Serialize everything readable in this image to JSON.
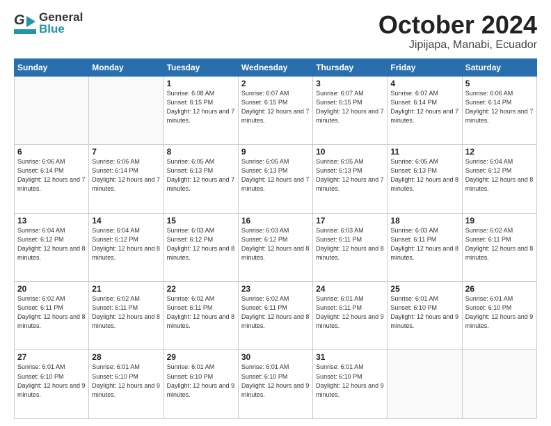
{
  "header": {
    "logo_general": "General",
    "logo_blue": "Blue",
    "title": "October 2024",
    "subtitle": "Jipijapa, Manabi, Ecuador"
  },
  "calendar": {
    "days_of_week": [
      "Sunday",
      "Monday",
      "Tuesday",
      "Wednesday",
      "Thursday",
      "Friday",
      "Saturday"
    ],
    "weeks": [
      [
        {
          "day": "",
          "detail": ""
        },
        {
          "day": "",
          "detail": ""
        },
        {
          "day": "1",
          "detail": "Sunrise: 6:08 AM\nSunset: 6:15 PM\nDaylight: 12 hours\nand 7 minutes."
        },
        {
          "day": "2",
          "detail": "Sunrise: 6:07 AM\nSunset: 6:15 PM\nDaylight: 12 hours\nand 7 minutes."
        },
        {
          "day": "3",
          "detail": "Sunrise: 6:07 AM\nSunset: 6:15 PM\nDaylight: 12 hours\nand 7 minutes."
        },
        {
          "day": "4",
          "detail": "Sunrise: 6:07 AM\nSunset: 6:14 PM\nDaylight: 12 hours\nand 7 minutes."
        },
        {
          "day": "5",
          "detail": "Sunrise: 6:06 AM\nSunset: 6:14 PM\nDaylight: 12 hours\nand 7 minutes."
        }
      ],
      [
        {
          "day": "6",
          "detail": "Sunrise: 6:06 AM\nSunset: 6:14 PM\nDaylight: 12 hours\nand 7 minutes."
        },
        {
          "day": "7",
          "detail": "Sunrise: 6:06 AM\nSunset: 6:14 PM\nDaylight: 12 hours\nand 7 minutes."
        },
        {
          "day": "8",
          "detail": "Sunrise: 6:05 AM\nSunset: 6:13 PM\nDaylight: 12 hours\nand 7 minutes."
        },
        {
          "day": "9",
          "detail": "Sunrise: 6:05 AM\nSunset: 6:13 PM\nDaylight: 12 hours\nand 7 minutes."
        },
        {
          "day": "10",
          "detail": "Sunrise: 6:05 AM\nSunset: 6:13 PM\nDaylight: 12 hours\nand 7 minutes."
        },
        {
          "day": "11",
          "detail": "Sunrise: 6:05 AM\nSunset: 6:13 PM\nDaylight: 12 hours\nand 8 minutes."
        },
        {
          "day": "12",
          "detail": "Sunrise: 6:04 AM\nSunset: 6:12 PM\nDaylight: 12 hours\nand 8 minutes."
        }
      ],
      [
        {
          "day": "13",
          "detail": "Sunrise: 6:04 AM\nSunset: 6:12 PM\nDaylight: 12 hours\nand 8 minutes."
        },
        {
          "day": "14",
          "detail": "Sunrise: 6:04 AM\nSunset: 6:12 PM\nDaylight: 12 hours\nand 8 minutes."
        },
        {
          "day": "15",
          "detail": "Sunrise: 6:03 AM\nSunset: 6:12 PM\nDaylight: 12 hours\nand 8 minutes."
        },
        {
          "day": "16",
          "detail": "Sunrise: 6:03 AM\nSunset: 6:12 PM\nDaylight: 12 hours\nand 8 minutes."
        },
        {
          "day": "17",
          "detail": "Sunrise: 6:03 AM\nSunset: 6:11 PM\nDaylight: 12 hours\nand 8 minutes."
        },
        {
          "day": "18",
          "detail": "Sunrise: 6:03 AM\nSunset: 6:11 PM\nDaylight: 12 hours\nand 8 minutes."
        },
        {
          "day": "19",
          "detail": "Sunrise: 6:02 AM\nSunset: 6:11 PM\nDaylight: 12 hours\nand 8 minutes."
        }
      ],
      [
        {
          "day": "20",
          "detail": "Sunrise: 6:02 AM\nSunset: 6:11 PM\nDaylight: 12 hours\nand 8 minutes."
        },
        {
          "day": "21",
          "detail": "Sunrise: 6:02 AM\nSunset: 6:11 PM\nDaylight: 12 hours\nand 8 minutes."
        },
        {
          "day": "22",
          "detail": "Sunrise: 6:02 AM\nSunset: 6:11 PM\nDaylight: 12 hours\nand 8 minutes."
        },
        {
          "day": "23",
          "detail": "Sunrise: 6:02 AM\nSunset: 6:11 PM\nDaylight: 12 hours\nand 8 minutes."
        },
        {
          "day": "24",
          "detail": "Sunrise: 6:01 AM\nSunset: 6:11 PM\nDaylight: 12 hours\nand 9 minutes."
        },
        {
          "day": "25",
          "detail": "Sunrise: 6:01 AM\nSunset: 6:10 PM\nDaylight: 12 hours\nand 9 minutes."
        },
        {
          "day": "26",
          "detail": "Sunrise: 6:01 AM\nSunset: 6:10 PM\nDaylight: 12 hours\nand 9 minutes."
        }
      ],
      [
        {
          "day": "27",
          "detail": "Sunrise: 6:01 AM\nSunset: 6:10 PM\nDaylight: 12 hours\nand 9 minutes."
        },
        {
          "day": "28",
          "detail": "Sunrise: 6:01 AM\nSunset: 6:10 PM\nDaylight: 12 hours\nand 9 minutes."
        },
        {
          "day": "29",
          "detail": "Sunrise: 6:01 AM\nSunset: 6:10 PM\nDaylight: 12 hours\nand 9 minutes."
        },
        {
          "day": "30",
          "detail": "Sunrise: 6:01 AM\nSunset: 6:10 PM\nDaylight: 12 hours\nand 9 minutes."
        },
        {
          "day": "31",
          "detail": "Sunrise: 6:01 AM\nSunset: 6:10 PM\nDaylight: 12 hours\nand 9 minutes."
        },
        {
          "day": "",
          "detail": ""
        },
        {
          "day": "",
          "detail": ""
        }
      ]
    ]
  }
}
